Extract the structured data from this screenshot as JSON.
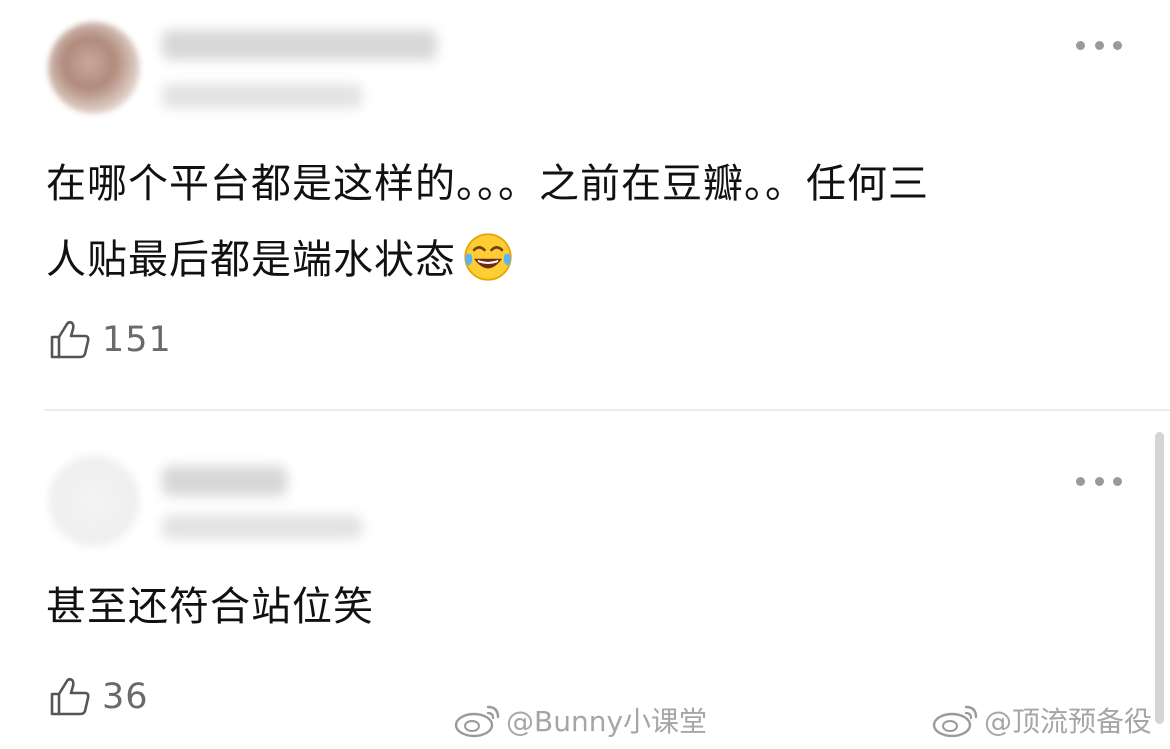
{
  "comments": [
    {
      "text_lines": [
        "在哪个平台都是这样的。。。之前在豆瓣。。任何三",
        "人贴最后都是端水状态"
      ],
      "emoji": "laughing-tears-emoji",
      "likes": "151"
    },
    {
      "text_lines": [
        "甚至还符合站位笑"
      ],
      "likes": "36"
    }
  ],
  "watermarks": [
    "@Bunny小课堂",
    "@顶流预备役"
  ],
  "icons": {
    "more": "more-dots-icon",
    "like": "thumb-up-icon",
    "watermark_logo": "weibo-logo-icon"
  },
  "colors": {
    "text": "#111111",
    "meta": "#6a6a6a",
    "divider": "#ededed",
    "watermark": "#969696"
  }
}
